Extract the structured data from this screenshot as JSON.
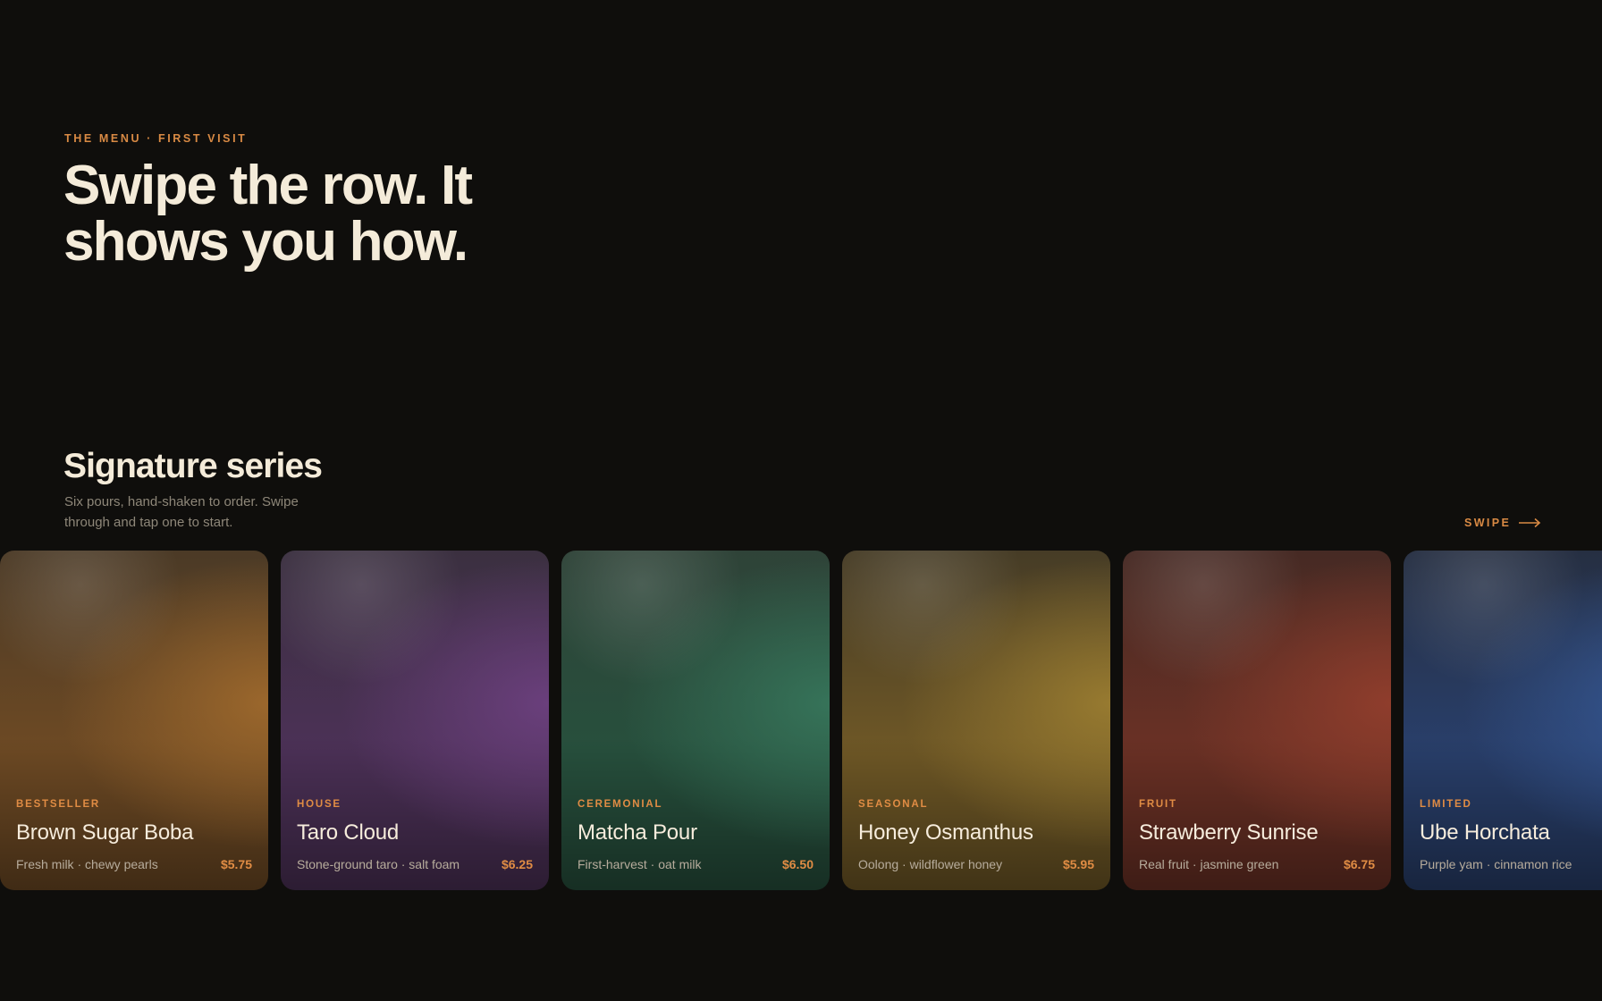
{
  "hero": {
    "eyebrow": "THE MENU · FIRST VISIT",
    "title": "Swipe the row. It shows you how."
  },
  "section": {
    "title": "Signature series",
    "subtitle": "Six pours, hand-shaken to order. Swipe through and tap one to start.",
    "swipe_label": "SWIPE",
    "swipe_icon": "arrow-right-icon"
  },
  "cards": [
    {
      "tag": "BESTSELLER",
      "name": "Brown Sugar Boba",
      "desc": "Fresh milk · chewy pearls",
      "price": "$5.75",
      "colors": {
        "top": "#4b3a26",
        "base": "#6e4a24",
        "glow": "#9b672c"
      }
    },
    {
      "tag": "HOUSE",
      "name": "Taro Cloud",
      "desc": "Stone-ground taro · salt foam",
      "price": "$6.25",
      "colors": {
        "top": "#3b3040",
        "base": "#4c3157",
        "glow": "#6a3f7c"
      }
    },
    {
      "tag": "CEREMONIAL",
      "name": "Matcha Pour",
      "desc": "First-harvest · oat milk",
      "price": "$6.50",
      "colors": {
        "top": "#2f4338",
        "base": "#27503d",
        "glow": "#367359"
      }
    },
    {
      "tag": "SEASONAL",
      "name": "Honey Osmanthus",
      "desc": "Oolong · wildflower honey",
      "price": "$5.95",
      "colors": {
        "top": "#463c26",
        "base": "#6f5826",
        "glow": "#977a30"
      }
    },
    {
      "tag": "FRUIT",
      "name": "Strawberry Sunrise",
      "desc": "Real fruit · jasmine green",
      "price": "$6.75",
      "colors": {
        "top": "#462a24",
        "base": "#6b3125",
        "glow": "#8f3d2c"
      }
    },
    {
      "tag": "LIMITED",
      "name": "Ube Horchata",
      "desc": "Purple yam · cinnamon rice",
      "price": "",
      "colors": {
        "top": "#262f42",
        "base": "#293f6b",
        "glow": "#355793"
      }
    }
  ]
}
